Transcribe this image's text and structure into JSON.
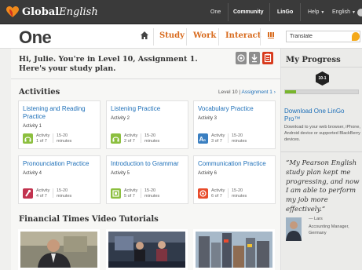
{
  "topbar": {
    "logo_text_a": "Global",
    "logo_text_b": "English",
    "nav": [
      {
        "label": "One"
      },
      {
        "label": "Community"
      },
      {
        "label": "LinGo"
      },
      {
        "label": "Help"
      },
      {
        "label": "English"
      }
    ]
  },
  "header": {
    "brand": "One",
    "tabs": [
      {
        "label": "Study"
      },
      {
        "label": "Work"
      },
      {
        "label": "Interact"
      }
    ],
    "translate_value": "Translate"
  },
  "greeting": {
    "line1": "Hi, Julie. You're in Level 10, Assignment 1.",
    "line2": "Here's your study plan."
  },
  "activities": {
    "title": "Activities",
    "level_text": "Level 10",
    "assignment_link": "Assignment 1",
    "activity_label": "Activity",
    "minutes_range": "15-20",
    "minutes_label": "minutes",
    "cards": [
      {
        "title": "Listening and Reading Practice",
        "sub": "Activity 1",
        "count": "1 of 7",
        "color": "#8cbf3f"
      },
      {
        "title": "Listening Practice",
        "sub": "Activity 2",
        "count": "2 of 7",
        "color": "#8cbf3f"
      },
      {
        "title": "Vocabulary Practice",
        "sub": "Activity 3",
        "count": "3 of 7",
        "color": "#3a7fc1"
      },
      {
        "title": "Pronounciation Practice",
        "sub": "Activity 4",
        "count": "4 of 7",
        "color": "#c2334f"
      },
      {
        "title": "Introduction to Grammar",
        "sub": "Activity 5",
        "count": "5 of 7",
        "color": "#8cbf3f"
      },
      {
        "title": "Communication Practice",
        "sub": "Activity 6",
        "count": "6 of 7",
        "color": "#e84c2b"
      }
    ]
  },
  "videos": {
    "title": "Financial Times Video Tutorials"
  },
  "sidebar": {
    "title": "My Progress",
    "badge": "10-1",
    "progress_fraction": 0.15,
    "download_title": "Download One LinGo Pro™",
    "download_desc": "Download to your web browser, iPhone, Android device or supported BlackBerry devices.",
    "quote": "“My Pearson English study plan kept me progressing, and now I am able to perform my job more effectively.”",
    "quote_name": "— Lars",
    "quote_role": "Accounting Manager, Germany"
  },
  "colors": {
    "accent_orange": "#d86b1e",
    "link_blue": "#1d6fb8",
    "progress_green": "#78b52c"
  }
}
